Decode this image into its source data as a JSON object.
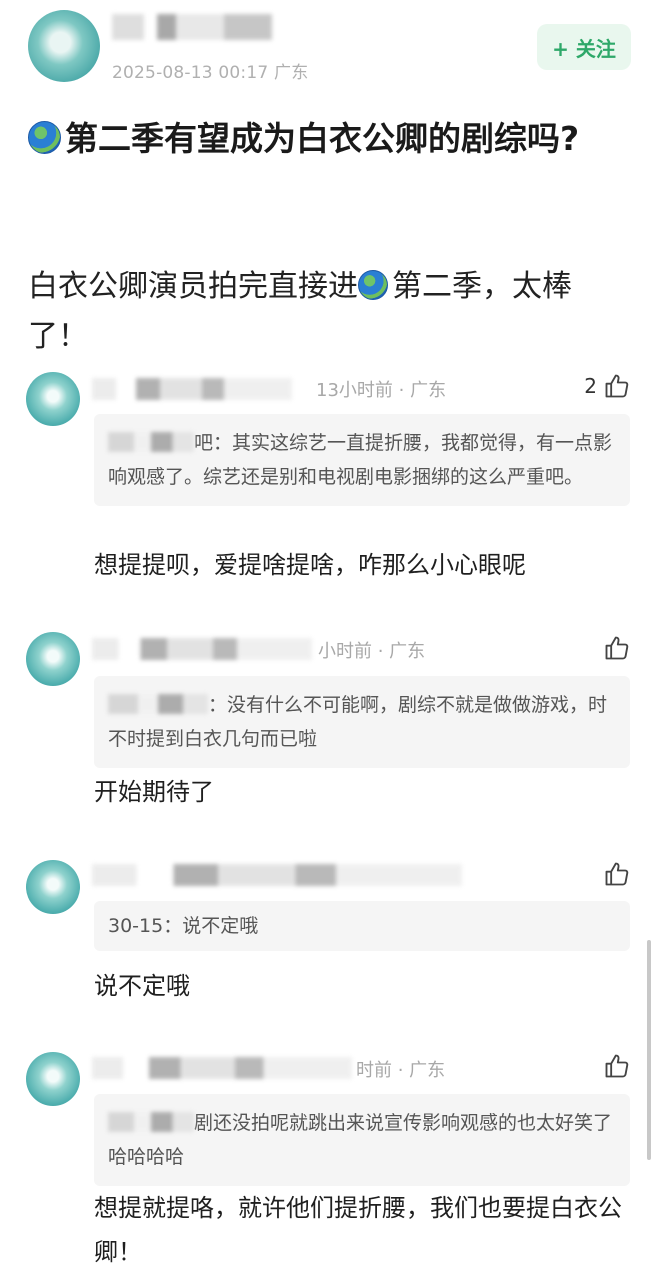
{
  "post": {
    "meta": "2025-08-13 00:17 广东",
    "follow_label": "+ 关注",
    "title": "第二季有望成为白衣公卿的剧综吗?",
    "body_part1": "白衣公卿演员拍完直接进",
    "body_part2": "第二季，太棒了！"
  },
  "comments": [
    {
      "time": "13小时前 · 广东",
      "likes": "2",
      "quote_label": "吧：",
      "quote_text": "其实这综艺一直提折腰，我都觉得，有一点影响观感了。综艺还是别和电视剧电影捆绑的这么严重吧。",
      "text": "想提提呗，爱提啥提啥，咋那么小心眼呢"
    },
    {
      "time": "小时前 · 广东",
      "likes": "",
      "quote_label": "：",
      "quote_text": "没有什么不可能啊，剧综不就是做做游戏，时不时提到白衣几句而已啦",
      "text": "开始期待了"
    },
    {
      "time": "",
      "likes": "",
      "quote_label": "30-15：",
      "quote_text": "说不定哦",
      "text": "说不定哦"
    },
    {
      "time": "时前 · 广东",
      "likes": "",
      "quote_label": "",
      "quote_text": "剧还没拍呢就跳出来说宣传影响观感的也太好笑了哈哈哈哈",
      "text": "想提就提咯，就许他们提折腰，我们也要提白衣公卿！"
    }
  ],
  "colors": {
    "follow_text": "#2ea869",
    "follow_bg": "#e9f7ee",
    "meta_gray": "#a8a8a8",
    "quote_bg": "#f5f5f5"
  },
  "icons": [
    "globe-emoji-icon",
    "thumbs-up-icon"
  ]
}
